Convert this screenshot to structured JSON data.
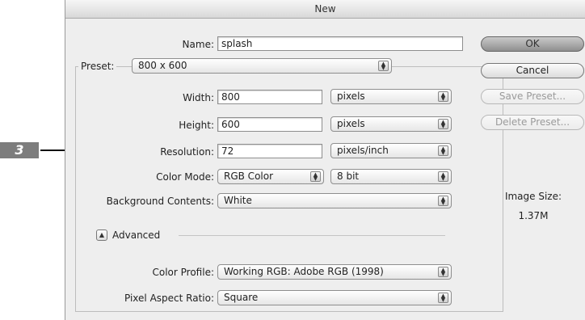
{
  "callout": {
    "step_number": "3"
  },
  "dialog": {
    "title": "New",
    "name_label": "Name:",
    "name_value": "splash",
    "preset_label": "Preset:",
    "preset_value": "800 x 600",
    "width_label": "Width:",
    "width_value": "800",
    "width_unit": "pixels",
    "height_label": "Height:",
    "height_value": "600",
    "height_unit": "pixels",
    "resolution_label": "Resolution:",
    "resolution_value": "72",
    "resolution_unit": "pixels/inch",
    "color_mode_label": "Color Mode:",
    "color_mode_value": "RGB Color",
    "bit_depth_value": "8 bit",
    "background_label": "Background Contents:",
    "background_value": "White",
    "advanced_label": "Advanced",
    "color_profile_label": "Color Profile:",
    "color_profile_value": "Working RGB:  Adobe RGB (1998)",
    "pixel_aspect_label": "Pixel Aspect Ratio:",
    "pixel_aspect_value": "Square"
  },
  "buttons": {
    "ok": "OK",
    "cancel": "Cancel",
    "save_preset": "Save Preset...",
    "delete_preset": "Delete Preset..."
  },
  "image_size": {
    "label": "Image Size:",
    "value": "1.37M"
  },
  "icons": {
    "step_arrow": "right-arrow-icon",
    "popup_arrows": "up-down-arrows-icon",
    "disclosure": "disclosure-triangle-icon"
  }
}
